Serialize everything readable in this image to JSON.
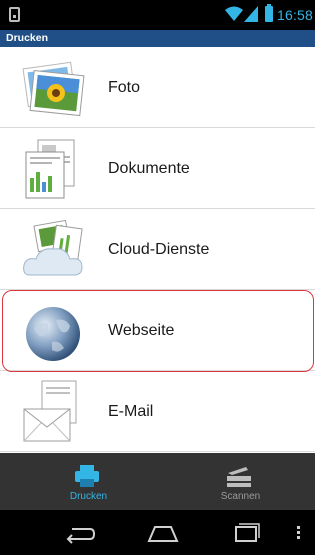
{
  "status_bar": {
    "time": "16:58",
    "icons": [
      "notification-icon",
      "wifi-icon",
      "signal-icon",
      "battery-icon"
    ],
    "accent_color": "#33b5e5"
  },
  "action_bar": {
    "title": "Drucken",
    "color": "#1f4f86"
  },
  "list": {
    "items": [
      {
        "label": "Foto",
        "icon": "photo-icon"
      },
      {
        "label": "Dokumente",
        "icon": "documents-icon"
      },
      {
        "label": "Cloud-Dienste",
        "icon": "cloud-services-icon"
      },
      {
        "label": "Webseite",
        "icon": "globe-icon",
        "highlighted": true
      },
      {
        "label": "E-Mail",
        "icon": "email-icon"
      }
    ],
    "highlight_color": "#d9363e"
  },
  "tab_bar": {
    "tabs": [
      {
        "label": "Drucken",
        "icon": "printer-icon",
        "selected": true
      },
      {
        "label": "Scannen",
        "icon": "scanner-icon",
        "selected": false
      }
    ]
  },
  "nav_bar": {
    "buttons": [
      "back-icon",
      "home-icon",
      "recent-apps-icon",
      "menu-icon"
    ]
  }
}
